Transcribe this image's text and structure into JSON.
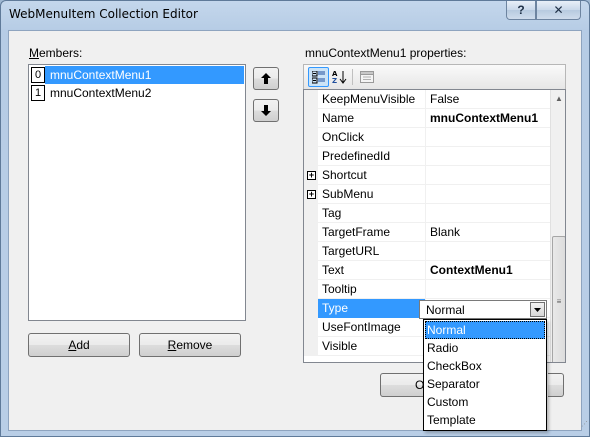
{
  "window": {
    "title": "WebMenuItem Collection Editor",
    "help_label": "?",
    "close_label": "✕"
  },
  "members": {
    "label_accel": "M",
    "label_rest": "embers:",
    "items": [
      {
        "index": "0",
        "text": "mnuContextMenu1",
        "selected": true
      },
      {
        "index": "1",
        "text": "mnuContextMenu2",
        "selected": false
      }
    ],
    "move_up_icon": "up-arrow-icon",
    "move_down_icon": "down-arrow-icon"
  },
  "buttons": {
    "add_accel": "A",
    "add_rest": "dd",
    "remove_accel": "R",
    "remove_rest": "emove",
    "ok_partial": "O"
  },
  "properties": {
    "label": "mnuContextMenu1 properties:",
    "rows": [
      {
        "name": "KeepMenuVisible",
        "value": "False",
        "bold": false,
        "expandable": false
      },
      {
        "name": "Name",
        "value": "mnuContextMenu1",
        "bold": true,
        "expandable": false
      },
      {
        "name": "OnClick",
        "value": "",
        "bold": false,
        "expandable": false
      },
      {
        "name": "PredefinedId",
        "value": "",
        "bold": false,
        "expandable": false
      },
      {
        "name": "Shortcut",
        "value": "",
        "bold": false,
        "expandable": true
      },
      {
        "name": "SubMenu",
        "value": "",
        "bold": false,
        "expandable": true
      },
      {
        "name": "Tag",
        "value": "",
        "bold": false,
        "expandable": false
      },
      {
        "name": "TargetFrame",
        "value": "Blank",
        "bold": false,
        "expandable": false
      },
      {
        "name": "TargetURL",
        "value": "",
        "bold": false,
        "expandable": false
      },
      {
        "name": "Text",
        "value": "ContextMenu1",
        "bold": true,
        "expandable": false
      },
      {
        "name": "Tooltip",
        "value": "",
        "bold": false,
        "expandable": false
      },
      {
        "name": "Type",
        "value": "",
        "bold": false,
        "expandable": false,
        "selected": true
      },
      {
        "name": "UseFontImage",
        "value": "",
        "bold": false,
        "expandable": false
      },
      {
        "name": "Visible",
        "value": "",
        "bold": false,
        "expandable": false
      }
    ]
  },
  "type_combo": {
    "value": "Normal",
    "options": [
      "Normal",
      "Radio",
      "CheckBox",
      "Separator",
      "Custom",
      "Template"
    ],
    "selected_index": 0
  },
  "colors": {
    "selection": "#3399ff",
    "frame": "#b9cee6"
  }
}
